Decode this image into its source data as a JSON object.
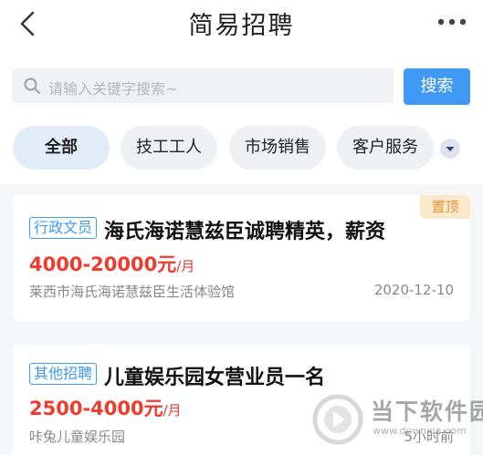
{
  "header": {
    "title": "简易招聘",
    "back_icon": "chevron-left-icon",
    "more_icon": "more-dots-icon"
  },
  "search": {
    "placeholder": "请输入关键字搜索~",
    "button_label": "搜索",
    "icon": "search-icon"
  },
  "categories": {
    "items": [
      {
        "label": "全部",
        "active": true
      },
      {
        "label": "技工工人",
        "active": false
      },
      {
        "label": "市场销售",
        "active": false
      },
      {
        "label": "客户服务",
        "active": false
      }
    ],
    "expand_icon": "chevron-down-icon"
  },
  "jobs": [
    {
      "tag": "行政文员",
      "title": "海氏海诺慧兹臣诚聘精英，薪资",
      "salary": "4000-20000元",
      "salary_unit": "/月",
      "company": "莱西市海氏海诺慧兹臣生活体验馆",
      "time": "2020-12-10",
      "badge": "置顶"
    },
    {
      "tag": "其他招聘",
      "title": "儿童娱乐园女营业员一名",
      "salary": "2500-4000元",
      "salary_unit": "/月",
      "company": "咔兔儿童娱乐园",
      "time": "5小时前"
    }
  ],
  "watermark": {
    "name": "当下软件园",
    "url": "www.downxia.com"
  },
  "colors": {
    "accent": "#3f99f5",
    "salary": "#f03a2d",
    "pin_badge_bg": "#fbe9cc",
    "pin_badge_text": "#e7923a"
  }
}
